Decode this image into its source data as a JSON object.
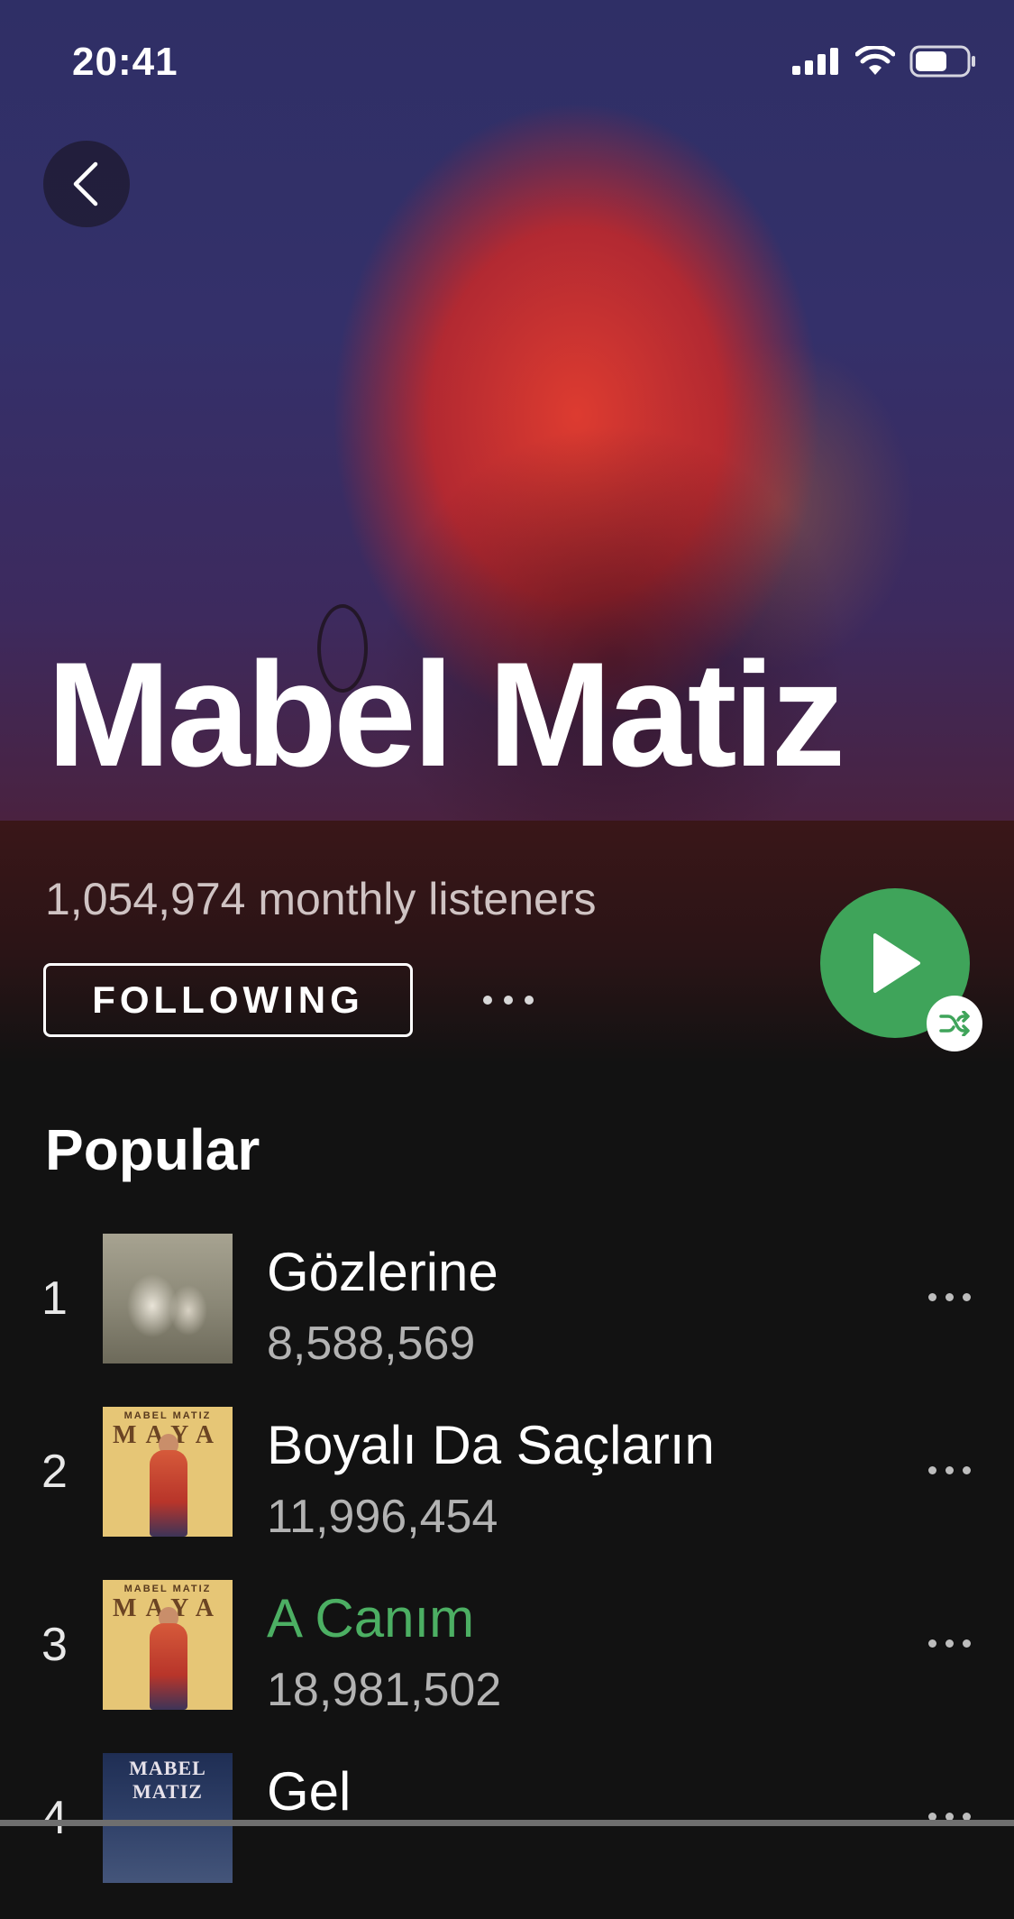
{
  "status_bar": {
    "time": "20:41"
  },
  "artist": {
    "name": "Mabel Matiz",
    "monthly_listeners": "1,054,974 monthly listeners",
    "follow_label": "FOLLOWING"
  },
  "section": {
    "title": "Popular"
  },
  "tracks": [
    {
      "number": "1",
      "title": "Gözlerine",
      "plays": "8,588,569",
      "active": false
    },
    {
      "number": "2",
      "title": "Boyalı Da Saçların",
      "plays": "11,996,454",
      "active": false
    },
    {
      "number": "3",
      "title": "A Canım",
      "plays": "18,981,502",
      "active": true
    },
    {
      "number": "4",
      "title": "Gel",
      "plays": "",
      "active": false
    }
  ],
  "covers": {
    "maya_top": "MABEL MATIZ",
    "maya_title": "MAYA",
    "gel_title": "MABEL MATIZ"
  },
  "colors": {
    "accent_green": "#3fa45a",
    "active_track": "#4caf63",
    "background": "#121212"
  },
  "icons": {
    "back": "chevron-left-icon",
    "play": "play-icon",
    "shuffle": "shuffle-icon",
    "more": "more-horizontal-icon"
  }
}
